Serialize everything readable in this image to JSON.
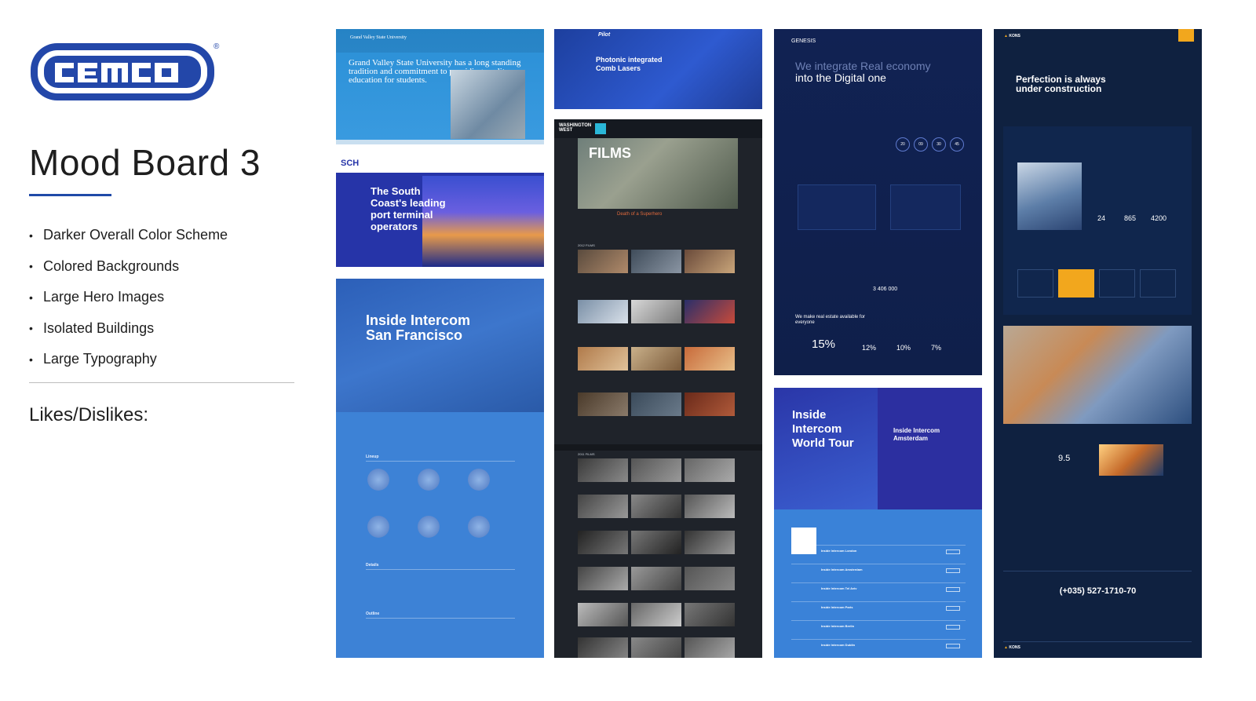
{
  "logo": {
    "text": "CEMCO",
    "registered": "®",
    "color": "#2347a9"
  },
  "title": "Mood Board 3",
  "accent_color": "#1f4aa8",
  "bullets": [
    "Darker Overall Color Scheme",
    "Colored Backgrounds",
    "Large Hero Images",
    "Isolated Buildings",
    "Large Typography"
  ],
  "likes_heading": "Likes/Dislikes:",
  "thumbnails": {
    "grand_valley": {
      "brand": "Grand Valley State University",
      "headline": "Grand Valley State University has a long standing tradition and commitment to providing quality education for students."
    },
    "sch": {
      "brand": "SCH",
      "headline": "The South Coast's leading port terminal operators"
    },
    "intercom_sf": {
      "headline": "Inside Intercom San Francisco",
      "sections": [
        "Lineup",
        "Details",
        "Outline"
      ]
    },
    "pilot": {
      "brand": "Pilot",
      "headline": "Photonic integrated Comb Lasers"
    },
    "washington_west": {
      "brand": "WASHINGTON WEST",
      "hero_word": "FILMS",
      "feature": "Death of a Superhero",
      "grid_labels": [
        "2012 FILMS",
        "2011 FILMS"
      ]
    },
    "genesis": {
      "brand": "GENESIS",
      "headline_dim": "We integrate Real economy",
      "headline_bright": "into the Digital one",
      "counters": [
        "20",
        "09",
        "30",
        "45"
      ],
      "tagline": "We make real estate available for everyone",
      "big_value": "3 406 000",
      "stats": [
        "15%",
        "12%",
        "10%",
        "7%"
      ]
    },
    "intercom_world_tour": {
      "headline": "Inside Intercom World Tour",
      "side_heading": "Inside Intercom Amsterdam",
      "events": [
        "Inside Intercom London",
        "Inside Intercom Amsterdam",
        "Inside Intercom Tel Aviv",
        "Inside Intercom Paris",
        "Inside Intercom Berlin",
        "Inside Intercom Dublin"
      ]
    },
    "kons": {
      "brand": "KONS",
      "headline": "Perfection is always under construction",
      "numbers": [
        "24",
        "865",
        "4200"
      ],
      "score": "9.5",
      "phone": "(+035) 527-1710-70"
    }
  }
}
